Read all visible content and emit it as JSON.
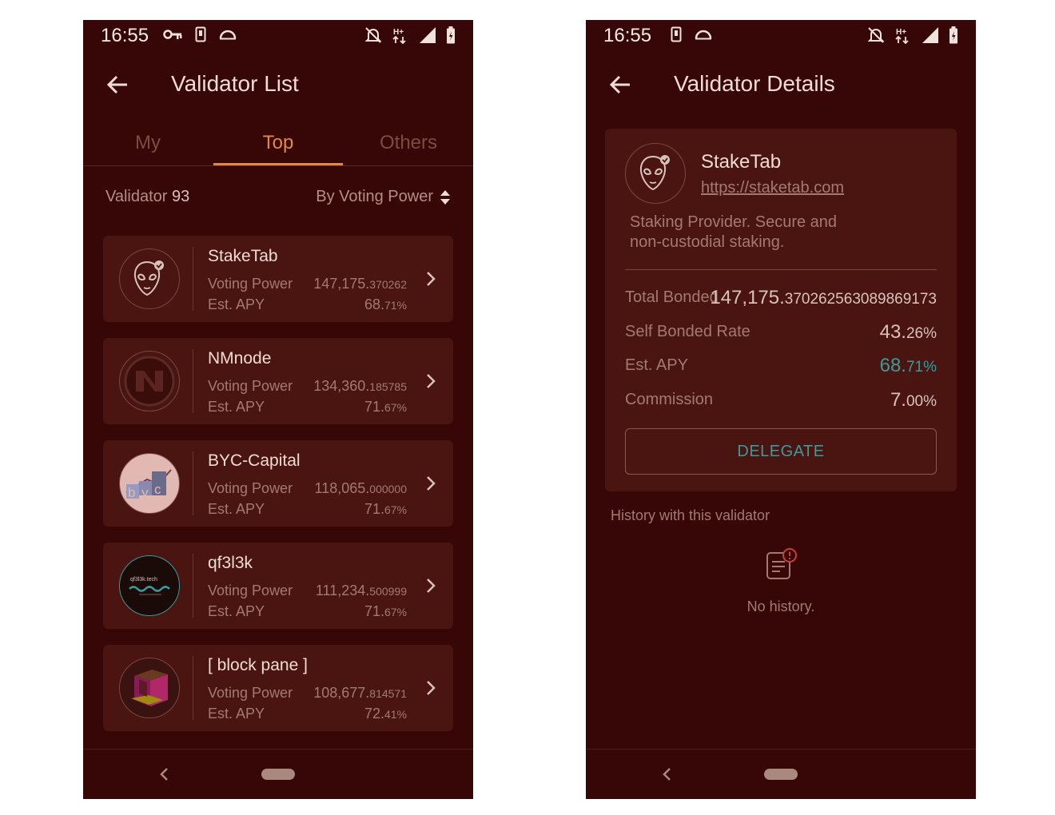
{
  "status_bar": {
    "time": "16:55"
  },
  "list_screen": {
    "title": "Validator List",
    "tabs": [
      {
        "label": "My",
        "active": false
      },
      {
        "label": "Top",
        "active": true
      },
      {
        "label": "Others",
        "active": false
      }
    ],
    "header": {
      "validator_label": "Validator",
      "validator_count": "93",
      "sort_label": "By Voting Power"
    },
    "labels": {
      "voting_power": "Voting Power",
      "est_apy": "Est. APY"
    },
    "validators": [
      {
        "name": "StakeTab",
        "vp_main": "147,175.",
        "vp_dec": "370262",
        "apy_main": "68.",
        "apy_dec": "71%",
        "logo": "alien-icon"
      },
      {
        "name": "NMnode",
        "vp_main": "134,360.",
        "vp_dec": "185785",
        "apy_main": "71.",
        "apy_dec": "67%",
        "logo": "nm-logo"
      },
      {
        "name": "BYC-Capital",
        "vp_main": "118,065.",
        "vp_dec": "000000",
        "apy_main": "71.",
        "apy_dec": "67%",
        "logo": "byc-logo"
      },
      {
        "name": "qf3l3k",
        "vp_main": "111,234.",
        "vp_dec": "500999",
        "apy_main": "71.",
        "apy_dec": "67%",
        "logo": "qf3l3k-logo"
      },
      {
        "name": "[ block pane ]",
        "vp_main": "108,677.",
        "vp_dec": "814571",
        "apy_main": "72.",
        "apy_dec": "41%",
        "logo": "block-pane-logo"
      }
    ],
    "logo_texts": {
      "byc_letters": [
        "b",
        "y",
        "c"
      ],
      "qf3l3k_text": "qf3l3k.tech"
    }
  },
  "detail_screen": {
    "title": "Validator Details",
    "name": "StakeTab",
    "url": "https://staketab.com",
    "description": "Staking Provider. Secure and non-custodial staking.",
    "rows": [
      {
        "label": "Total Bonded",
        "main": "147,175.",
        "dec": "370262563089869173",
        "highlight": false
      },
      {
        "label": "Self Bonded Rate",
        "main": "43.",
        "dec": "26%",
        "highlight": false
      },
      {
        "label": "Est. APY",
        "main": "68.",
        "dec": "71%",
        "highlight": true
      },
      {
        "label": "Commission",
        "main": "7.",
        "dec": "00%",
        "highlight": false
      }
    ],
    "delegate_label": "DELEGATE",
    "history_label": "History with this validator",
    "history_empty": "No history."
  },
  "colors": {
    "background": "#360706",
    "card": "#4a1511",
    "accent_orange": "#e08a40",
    "accent_teal": "#3b9a9a"
  }
}
